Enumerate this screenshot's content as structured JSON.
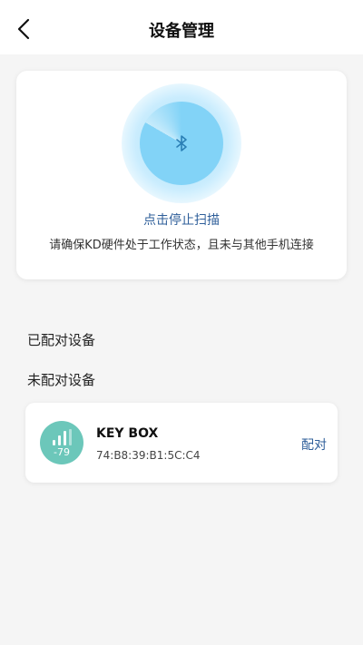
{
  "header": {
    "title": "设备管理",
    "back_icon": "chevron-left-icon"
  },
  "scan": {
    "action_label": "点击停止扫描",
    "tip": "请确保KD硬件处于工作状态，且未与其他手机连接",
    "icon": "bluetooth-icon",
    "accent_color": "#82d3f7"
  },
  "sections": {
    "paired_title": "已配对设备",
    "unpaired_title": "未配对设备"
  },
  "devices": [
    {
      "name": "KEY BOX",
      "mac": "74:B8:39:B1:5C:C4",
      "rssi": "-79",
      "signal_icon": "signal-strength-icon",
      "signal_color": "#6cc7ba",
      "action_label": "配对"
    }
  ],
  "colors": {
    "link": "#2f5f9a",
    "background": "#f5f5f5"
  }
}
